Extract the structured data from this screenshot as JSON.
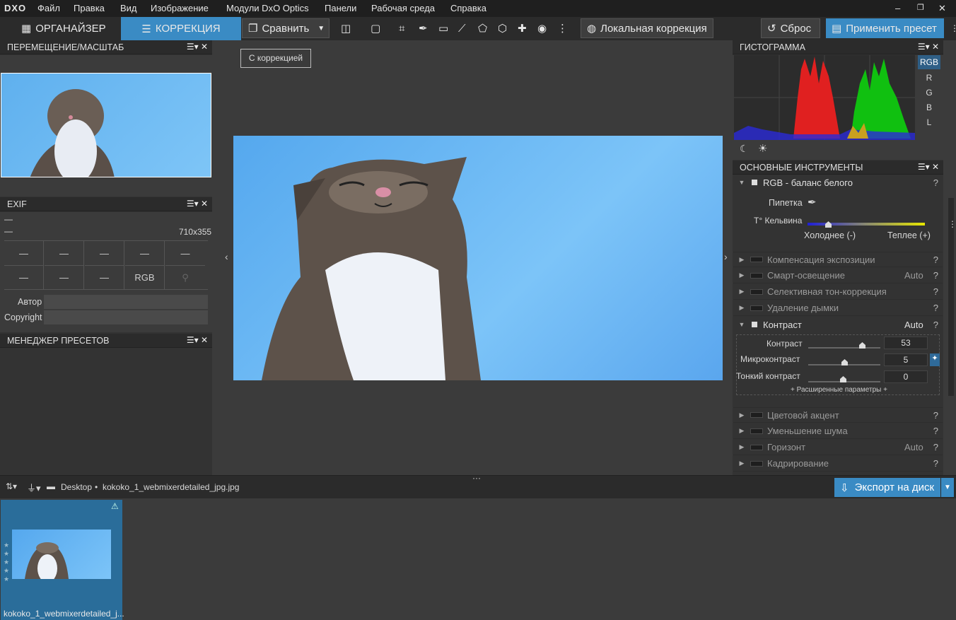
{
  "menu": {
    "logo": "DXO",
    "items": [
      "Файл",
      "Правка",
      "Вид",
      "Изображение",
      "Модули DxO Optics",
      "Панели",
      "Рабочая среда",
      "Справка"
    ]
  },
  "toolbar": {
    "organizer": "ОРГАНАЙЗЕР",
    "correction": "КОРРЕКЦИЯ",
    "compare": "Сравнить",
    "local": "Локальная коррекция",
    "reset": "Сброс",
    "apply_preset": "Применить пресет"
  },
  "left": {
    "nav_title": "ПЕРЕМЕЩЕНИЕ/МАСШТАБ",
    "exif_title": "EXIF",
    "exif_line1": "—",
    "exif_line2": "—",
    "exif_size": "710x355",
    "exif_cells": [
      "—",
      "—",
      "—",
      "—",
      "—",
      "—",
      "—",
      "—",
      "RGB"
    ],
    "author_label": "Автор",
    "copyright_label": "Copyright",
    "presets_title": "МЕНЕДЖЕР ПРЕСЕТОВ"
  },
  "viewer": {
    "badge": "С коррекцией"
  },
  "histogram": {
    "title": "ГИСТОГРАММА",
    "channels": [
      "RGB",
      "R",
      "G",
      "B",
      "L"
    ]
  },
  "tools": {
    "title": "ОСНОВНЫЕ ИНСТРУМЕНТЫ",
    "wb": {
      "label": "RGB - баланс белого",
      "picker": "Пипетка",
      "kelvin": "Т° Кельвина",
      "cold": "Холоднее (-)",
      "warm": "Теплее (+)"
    },
    "rows_top": [
      {
        "label": "Компенсация экспозиции",
        "auto": ""
      },
      {
        "label": "Смарт-освещение",
        "auto": "Auto"
      },
      {
        "label": "Селективная тон-коррекция",
        "auto": ""
      },
      {
        "label": "Удаление дымки",
        "auto": ""
      }
    ],
    "contrast": {
      "label": "Контраст",
      "auto": "Auto",
      "sliders": [
        {
          "label": "Контраст",
          "value": "53"
        },
        {
          "label": "Микроконтраст",
          "value": "5"
        },
        {
          "label": "Тонкий контраст",
          "value": "0"
        }
      ],
      "advanced": "+ Расширенные параметры +"
    },
    "rows_bottom": [
      {
        "label": "Цветовой акцент",
        "auto": ""
      },
      {
        "label": "Уменьшение шума",
        "auto": ""
      },
      {
        "label": "Горизонт",
        "auto": "Auto"
      },
      {
        "label": "Кадрирование",
        "auto": ""
      }
    ],
    "q": "?"
  },
  "filmstrip": {
    "path_folder": "Desktop",
    "path_sep": "•",
    "path_file": "kokoko_1_webmixerdetailed_jpg.jpg",
    "export": "Экспорт на диск",
    "thumb_name": "kokoko_1_webmixerdetailed_j..."
  }
}
